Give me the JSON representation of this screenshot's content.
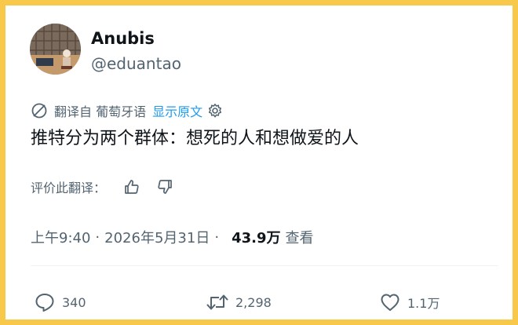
{
  "user": {
    "name": "Anubis",
    "handle": "@eduantao"
  },
  "translation": {
    "translated_from": "翻译自 葡萄牙语",
    "show_original": "显示原文"
  },
  "tweet": {
    "text": "推特分为两个群体：想死的人和想做爱的人"
  },
  "rating": {
    "label": "评价此翻译："
  },
  "meta": {
    "time": "上午9:40",
    "separator": "·",
    "date": "2026年5月31日",
    "views_count": "43.9万",
    "views_label": "查看"
  },
  "actions": {
    "replies": "340",
    "retweets": "2,298",
    "likes": "1.1万"
  },
  "colors": {
    "border": "#f7c84a",
    "accent": "#1d9bf0",
    "secondary_text": "#536471",
    "primary_text": "#0f1419"
  },
  "icons": [
    "translate-icon",
    "gear-icon",
    "thumbs-up-icon",
    "thumbs-down-icon",
    "reply-icon",
    "retweet-icon",
    "like-icon"
  ]
}
